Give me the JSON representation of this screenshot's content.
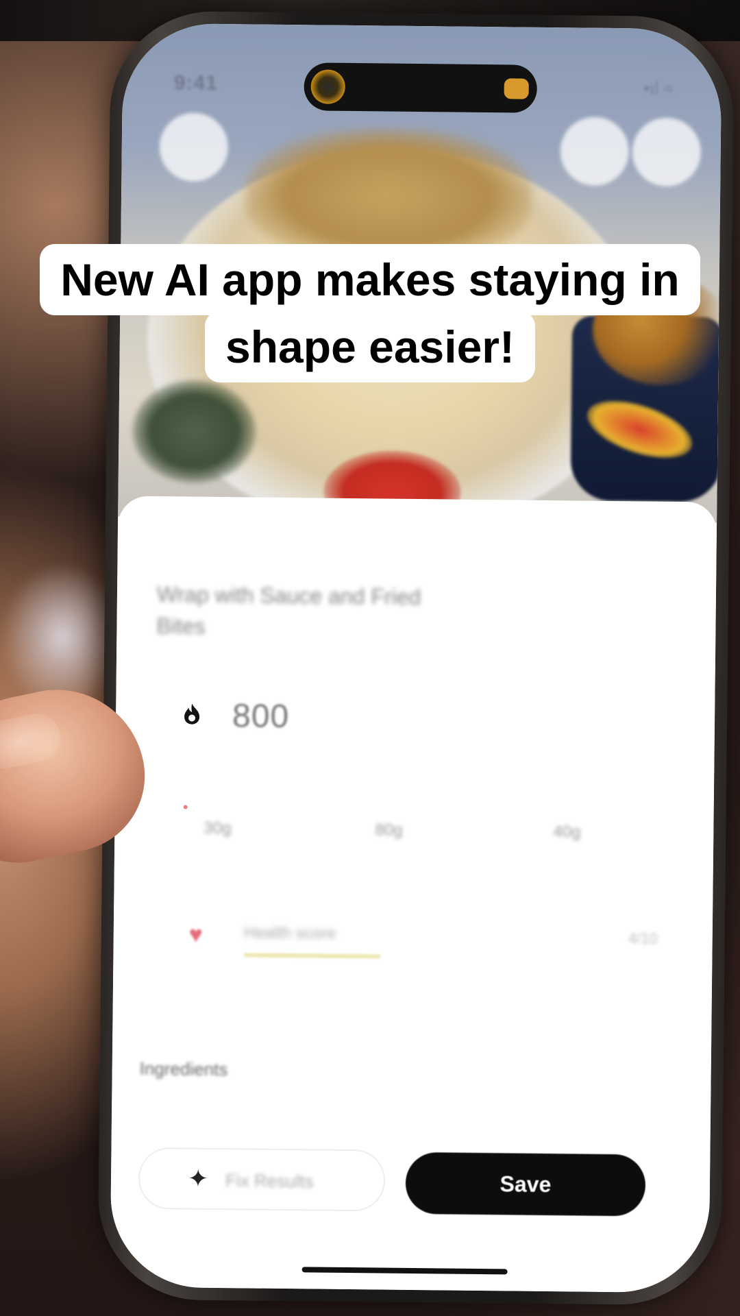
{
  "caption": {
    "line1": "New AI app makes staying in",
    "line2": "shape easier!"
  },
  "status_bar": {
    "time": "9:41",
    "indicators": "•ıl ≈"
  },
  "meal": {
    "title": "Wrap with Sauce and Fried Bites",
    "calories_icon": "flame-icon",
    "calories": "800",
    "macros": [
      {
        "value": "30g"
      },
      {
        "value": "80g"
      },
      {
        "value": "40g"
      }
    ],
    "health_icon": "heart-icon",
    "health_label": "Health score",
    "health_score": "4/10",
    "ingredients_label": "Ingredients"
  },
  "actions": {
    "fix_icon": "sparkle-icon",
    "fix_label": "Fix Results",
    "save_label": "Save"
  },
  "colors": {
    "save_button": "#0d0d0d",
    "caption_bg": "#ffffff",
    "heart": "#e46b7a"
  }
}
